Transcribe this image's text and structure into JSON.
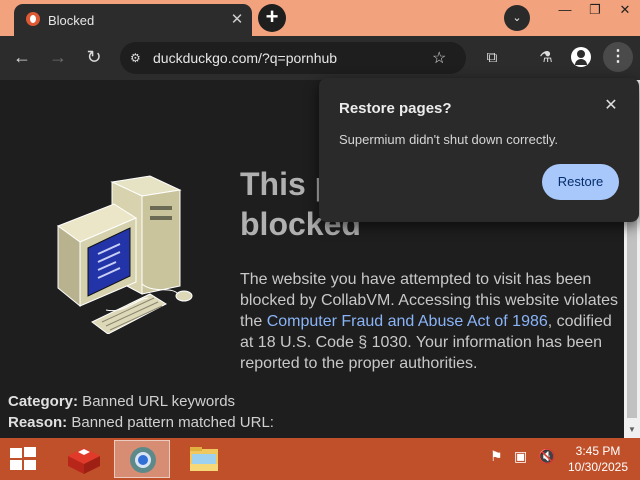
{
  "browser": {
    "tab": {
      "title": "Blocked",
      "close_glyph": "✕"
    },
    "new_tab_glyph": "+",
    "tab_search_glyph": "⌄",
    "window_controls": {
      "minimize": "—",
      "restore": "❐",
      "close": "✕"
    },
    "toolbar": {
      "back_glyph": "←",
      "forward_glyph": "→",
      "reload_glyph": "↻",
      "url": "duckduckgo.com/?q=pornhub",
      "site_info_glyph": "⚙",
      "bookmark_glyph": "☆",
      "extensions_glyph": "⧉",
      "labs_glyph": "⚗",
      "menu_glyph": "⋮"
    }
  },
  "page": {
    "heading": "This page has been blocked",
    "description_before_link": "The website you have attempted to visit has been blocked by CollabVM. Accessing this website violates the ",
    "link_text": "Computer Fraud and Abuse Act of 1986",
    "description_after_link": ", codified at 18 U.S. Code § 1030. Your information has been reported to the proper authorities.",
    "category_label": "Category:",
    "category_value": " Banned URL keywords",
    "reason_label": "Reason:",
    "reason_value": " Banned pattern matched URL:"
  },
  "popup": {
    "title": "Restore pages?",
    "message": "Supermium didn't shut down correctly.",
    "close_glyph": "✕",
    "restore_label": "Restore"
  },
  "taskbar": {
    "time": "3:45 PM",
    "date": "10/30/2025",
    "tray_icons": [
      "flag-icon",
      "network-icon",
      "volume-muted-icon"
    ]
  },
  "colors": {
    "tabstrip": "#f2a27c",
    "taskbar": "#c0502a",
    "link": "#8ab4f8",
    "restore_button": "#a8c7fa"
  }
}
